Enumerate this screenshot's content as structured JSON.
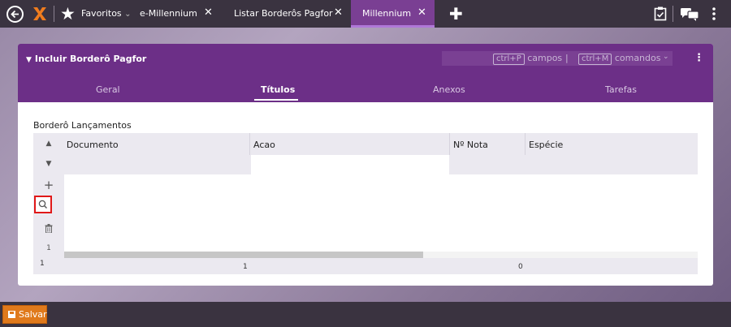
{
  "topbar": {
    "favorites_label": "Favoritos",
    "favorites_chevron": "⌄",
    "tabs": [
      {
        "label": "e-Millennium",
        "close": "✕"
      },
      {
        "label": "Listar Borderôs Pagfor",
        "close": "✕"
      },
      {
        "label": "Millennium",
        "close": "✕"
      }
    ],
    "new_tab": "✚"
  },
  "panel": {
    "title": "Incluir Borderô Pagfor",
    "shortcut_fields_key": "ctrl+P",
    "shortcut_fields_label": "campos",
    "shortcut_separator": "|",
    "shortcut_commands_key": "ctrl+M",
    "shortcut_commands_label": "comandos",
    "tabs": [
      "Geral",
      "Títulos",
      "Anexos",
      "Tarefas"
    ],
    "active_tab": "Títulos"
  },
  "grid": {
    "label": "Borderô Lançamentos",
    "columns": [
      "Nº Documento",
      "Acao",
      "Nº Nota",
      "Espécie"
    ],
    "row_marker": "1",
    "footer_left": "1",
    "footer_doc_count": "1",
    "footer_nota_count": "0"
  },
  "bottombar": {
    "save_label": "Salvar"
  },
  "colors": {
    "accent": "#6c2f87",
    "save": "#e07a1c",
    "highlight": "#e01818"
  }
}
